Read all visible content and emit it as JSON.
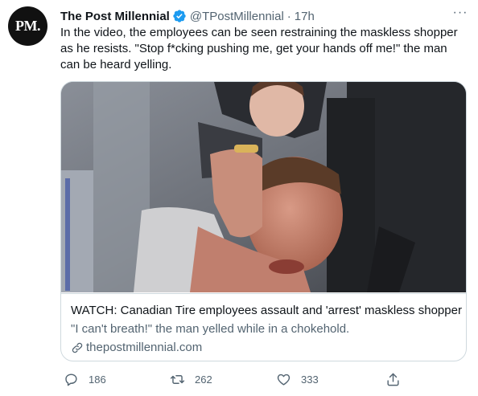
{
  "author": {
    "avatar_text": "PM.",
    "name": "The Post Millennial",
    "handle": "@TPostMillennial",
    "separator": "·",
    "time": "17h"
  },
  "more_label": "···",
  "tweet_text": "In the video, the employees can be seen restraining the maskless shopper as he resists. \"Stop f*cking pushing me, get your hands off me!\" the man can be heard yelling.",
  "card": {
    "title": "WATCH: Canadian Tire employees assault and 'arrest' maskless shopper",
    "description": "\"I can't breath!\" the man yelled while in a chokehold.",
    "domain": "thepostmillennial.com"
  },
  "actions": {
    "reply_count": "186",
    "retweet_count": "262",
    "like_count": "333"
  },
  "colors": {
    "verified": "#1d9bf0",
    "secondary_text": "#536471",
    "border": "#cfd9de"
  }
}
